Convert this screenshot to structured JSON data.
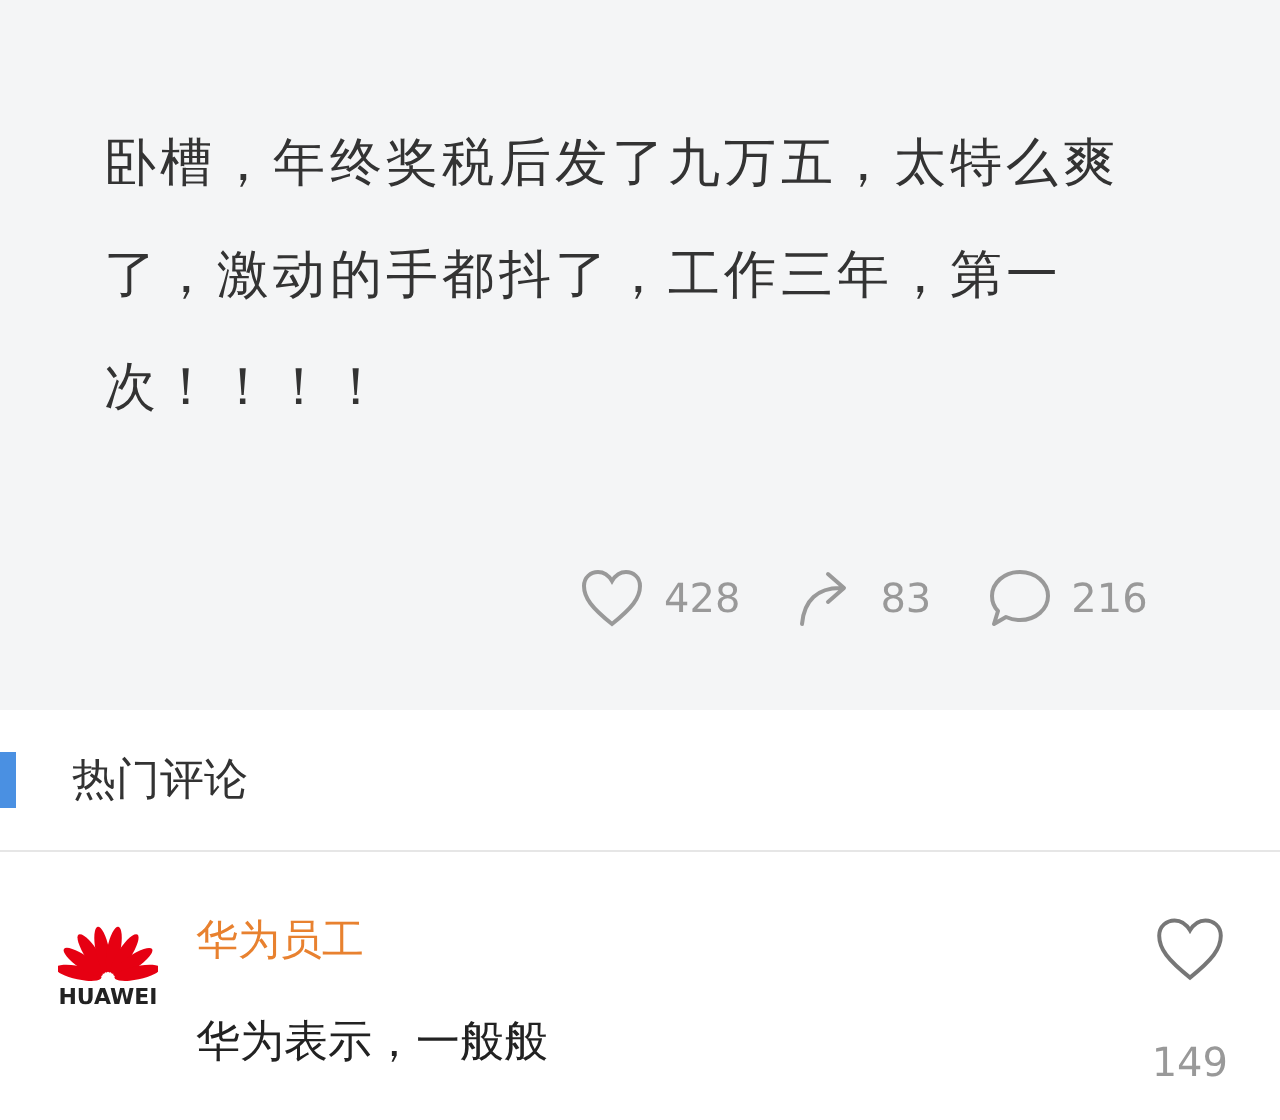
{
  "post": {
    "text": "卧槽，年终奖税后发了九万五，太特么爽了，激动的手都抖了，工作三年，第一次！！！！",
    "actions": [
      {
        "kind": "like",
        "count": "428"
      },
      {
        "kind": "share",
        "count": "83"
      },
      {
        "kind": "comment",
        "count": "216"
      }
    ]
  },
  "hot_comments": {
    "title": "热门评论",
    "comments": [
      {
        "logo_text": "HUAWEI",
        "user": "华为员工",
        "text": "华为表示，一般般",
        "likes": "149"
      }
    ]
  }
}
